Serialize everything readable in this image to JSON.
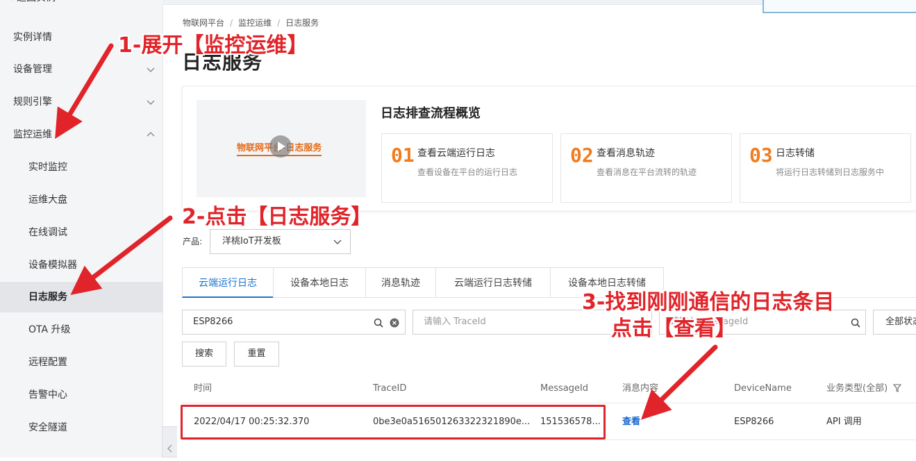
{
  "sidebar": {
    "top_label": "< 返回实例",
    "items": [
      {
        "label": "实例详情"
      },
      {
        "label": "设备管理"
      },
      {
        "label": "规则引擎"
      },
      {
        "label": "监控运维"
      },
      {
        "label": "实时监控"
      },
      {
        "label": "运维大盘"
      },
      {
        "label": "在线调试"
      },
      {
        "label": "设备模拟器"
      },
      {
        "label": "日志服务"
      },
      {
        "label": "OTA 升级"
      },
      {
        "label": "远程配置"
      },
      {
        "label": "告警中心"
      },
      {
        "label": "安全隧道"
      }
    ]
  },
  "breadcrumb": [
    "物联网平台",
    "监控运维",
    "日志服务"
  ],
  "breadcrumb_sep": "/",
  "page_title": "日志服务",
  "overview": {
    "video_caption": "物联网平台-日志服务",
    "title": "日志排查流程概览",
    "steps": [
      {
        "num": "01",
        "title": "查看云端运行日志",
        "desc": "查看设备在平台的运行日志"
      },
      {
        "num": "02",
        "title": "查看消息轨迹",
        "desc": "查看消息在平台流转的轨迹"
      },
      {
        "num": "03",
        "title": "日志转储",
        "desc": "将运行日志转储到日志服务中"
      }
    ]
  },
  "product": {
    "label": "产品:",
    "value": "洋桃IoT开发板"
  },
  "tabs": [
    "云端运行日志",
    "设备本地日志",
    "消息轨迹",
    "云端运行日志转储",
    "设备本地日志转储"
  ],
  "search": {
    "device_value": "ESP8266",
    "traceid_placeholder": "请输入 TraceId",
    "messageid_placeholder": "请输入 MessageId",
    "status_value": "全部状态"
  },
  "buttons": {
    "search": "搜索",
    "reset": "重置"
  },
  "table": {
    "headers": [
      "时间",
      "TraceID",
      "MessageId",
      "消息内容",
      "DeviceName",
      "业务类型(全部)"
    ],
    "rows": [
      [
        "2022/04/17 00:25:32.370",
        "0be3e0a516501263322321890e...",
        "151536578...",
        "查看",
        "ESP8266",
        "API 调用"
      ]
    ]
  },
  "annotations": {
    "a1": "1-展开【监控运维】",
    "a2": "2-点击【日志服务】",
    "a3_line1": "3-找到刚刚通信的日志条目",
    "a3_line2": "点击【查看】"
  },
  "colors": {
    "accent": "#1a73d0",
    "annotation": "#e0242a",
    "step_number": "#f07c1f"
  }
}
